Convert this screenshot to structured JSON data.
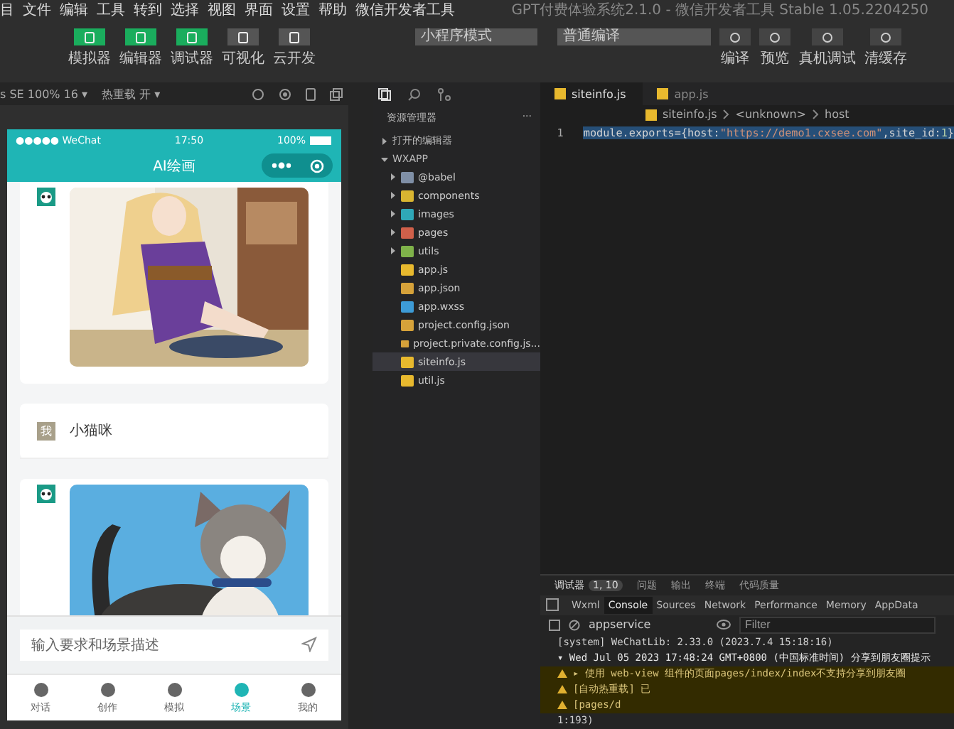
{
  "window": {
    "title": "GPT付费体验系统2.1.0 - 微信开发者工具 Stable 1.05.2204250"
  },
  "menu": [
    "目",
    "文件",
    "编辑",
    "工具",
    "转到",
    "选择",
    "视图",
    "界面",
    "设置",
    "帮助",
    "微信开发者工具"
  ],
  "mode_buttons": [
    {
      "label": "模拟器",
      "on": true
    },
    {
      "label": "编辑器",
      "on": true
    },
    {
      "label": "调试器",
      "on": true
    },
    {
      "label": "可视化",
      "on": false
    },
    {
      "label": "云开发",
      "on": false
    }
  ],
  "mode_select": "小程序模式",
  "compile_select": "普通编译",
  "actions": [
    "编译",
    "预览",
    "真机调试",
    "清缓存"
  ],
  "simulator": {
    "device": "s SE 100% 16 ▾",
    "hot_reload": "热重载 开 ▾"
  },
  "phone": {
    "carrier": "●●●●● WeChat",
    "time": "17:50",
    "battery": "100%",
    "title": "AI绘画",
    "messages": [
      {
        "kind": "bot_image"
      },
      {
        "kind": "user_text",
        "avatar": "我",
        "text": "小猫咪"
      },
      {
        "kind": "bot_image"
      }
    ],
    "input": {
      "placeholder": "输入要求和场景描述"
    },
    "tabs": [
      {
        "label": "对话",
        "selected": false
      },
      {
        "label": "创作",
        "selected": false
      },
      {
        "label": "模拟",
        "selected": false
      },
      {
        "label": "场景",
        "selected": true
      },
      {
        "label": "我的",
        "selected": false
      }
    ]
  },
  "explorer": {
    "title": "资源管理器",
    "more": "···",
    "sections": [
      {
        "label": "打开的编辑器",
        "expanded": false
      },
      {
        "label": "WXAPP",
        "expanded": true
      }
    ],
    "files": [
      {
        "name": "@babel",
        "kind": "folder",
        "color": "#7f8fa6",
        "selected": false
      },
      {
        "name": "components",
        "kind": "folder",
        "color": "#d9b531",
        "selected": false
      },
      {
        "name": "images",
        "kind": "folder",
        "color": "#2fa8b8",
        "selected": false
      },
      {
        "name": "pages",
        "kind": "folder",
        "color": "#d0604a",
        "selected": false
      },
      {
        "name": "utils",
        "kind": "folder",
        "color": "#7fb24a",
        "selected": false
      },
      {
        "name": "app.js",
        "kind": "js",
        "selected": false
      },
      {
        "name": "app.json",
        "kind": "json",
        "selected": false
      },
      {
        "name": "app.wxss",
        "kind": "wxss",
        "selected": false
      },
      {
        "name": "project.config.json",
        "kind": "json",
        "selected": false
      },
      {
        "name": "project.private.config.js...",
        "kind": "json",
        "selected": false
      },
      {
        "name": "siteinfo.js",
        "kind": "js",
        "selected": true
      },
      {
        "name": "util.js",
        "kind": "js",
        "selected": false
      }
    ]
  },
  "editor": {
    "tabs": [
      {
        "label": "siteinfo.js",
        "selected": true
      },
      {
        "label": "app.js",
        "selected": false
      }
    ],
    "breadcrumb": [
      "siteinfo.js",
      "<unknown>",
      "host"
    ],
    "lines": [
      {
        "number": "1",
        "tokens": [
          {
            "text": "module.exports={host:",
            "kind": "plain"
          },
          {
            "text": "\"https://demo1.cxsee.com\"",
            "kind": "string"
          },
          {
            "text": ",site_id:",
            "kind": "plain"
          },
          {
            "text": "1",
            "kind": "number"
          },
          {
            "text": "}",
            "kind": "plain"
          }
        ]
      }
    ]
  },
  "debugger": {
    "tabs": [
      {
        "label": "调试器",
        "badge": "1, 10",
        "selected": true
      },
      {
        "label": "问题",
        "selected": false
      },
      {
        "label": "输出",
        "selected": false
      },
      {
        "label": "终端",
        "selected": false
      },
      {
        "label": "代码质量",
        "selected": false
      }
    ],
    "panels": [
      {
        "label": "Wxml",
        "selected": false
      },
      {
        "label": "Console",
        "selected": true
      },
      {
        "label": "Sources",
        "selected": false
      },
      {
        "label": "Network",
        "selected": false
      },
      {
        "label": "Performance",
        "selected": false
      },
      {
        "label": "Memory",
        "selected": false
      },
      {
        "label": "AppData",
        "selected": false
      }
    ],
    "context": "appservice",
    "filter": {
      "placeholder": "Filter"
    },
    "lines": [
      {
        "kind": "info",
        "text": "[system] WeChatLib: 2.33.0 (2023.7.4 15:18:16)"
      },
      {
        "kind": "group",
        "text": "▾ Wed Jul 05 2023 17:48:24 GMT+0800 (中国标准时间) 分享到朋友圈提示"
      },
      {
        "kind": "warning",
        "text": "▸ 使用 web-view 组件的页面pages/index/index不支持分享到朋友圈"
      },
      {
        "kind": "warning",
        "text": "[自动热重载] 已"
      },
      {
        "kind": "warning",
        "text": "[pages/d"
      },
      {
        "kind": "plain",
        "text": "1:193)"
      }
    ]
  }
}
